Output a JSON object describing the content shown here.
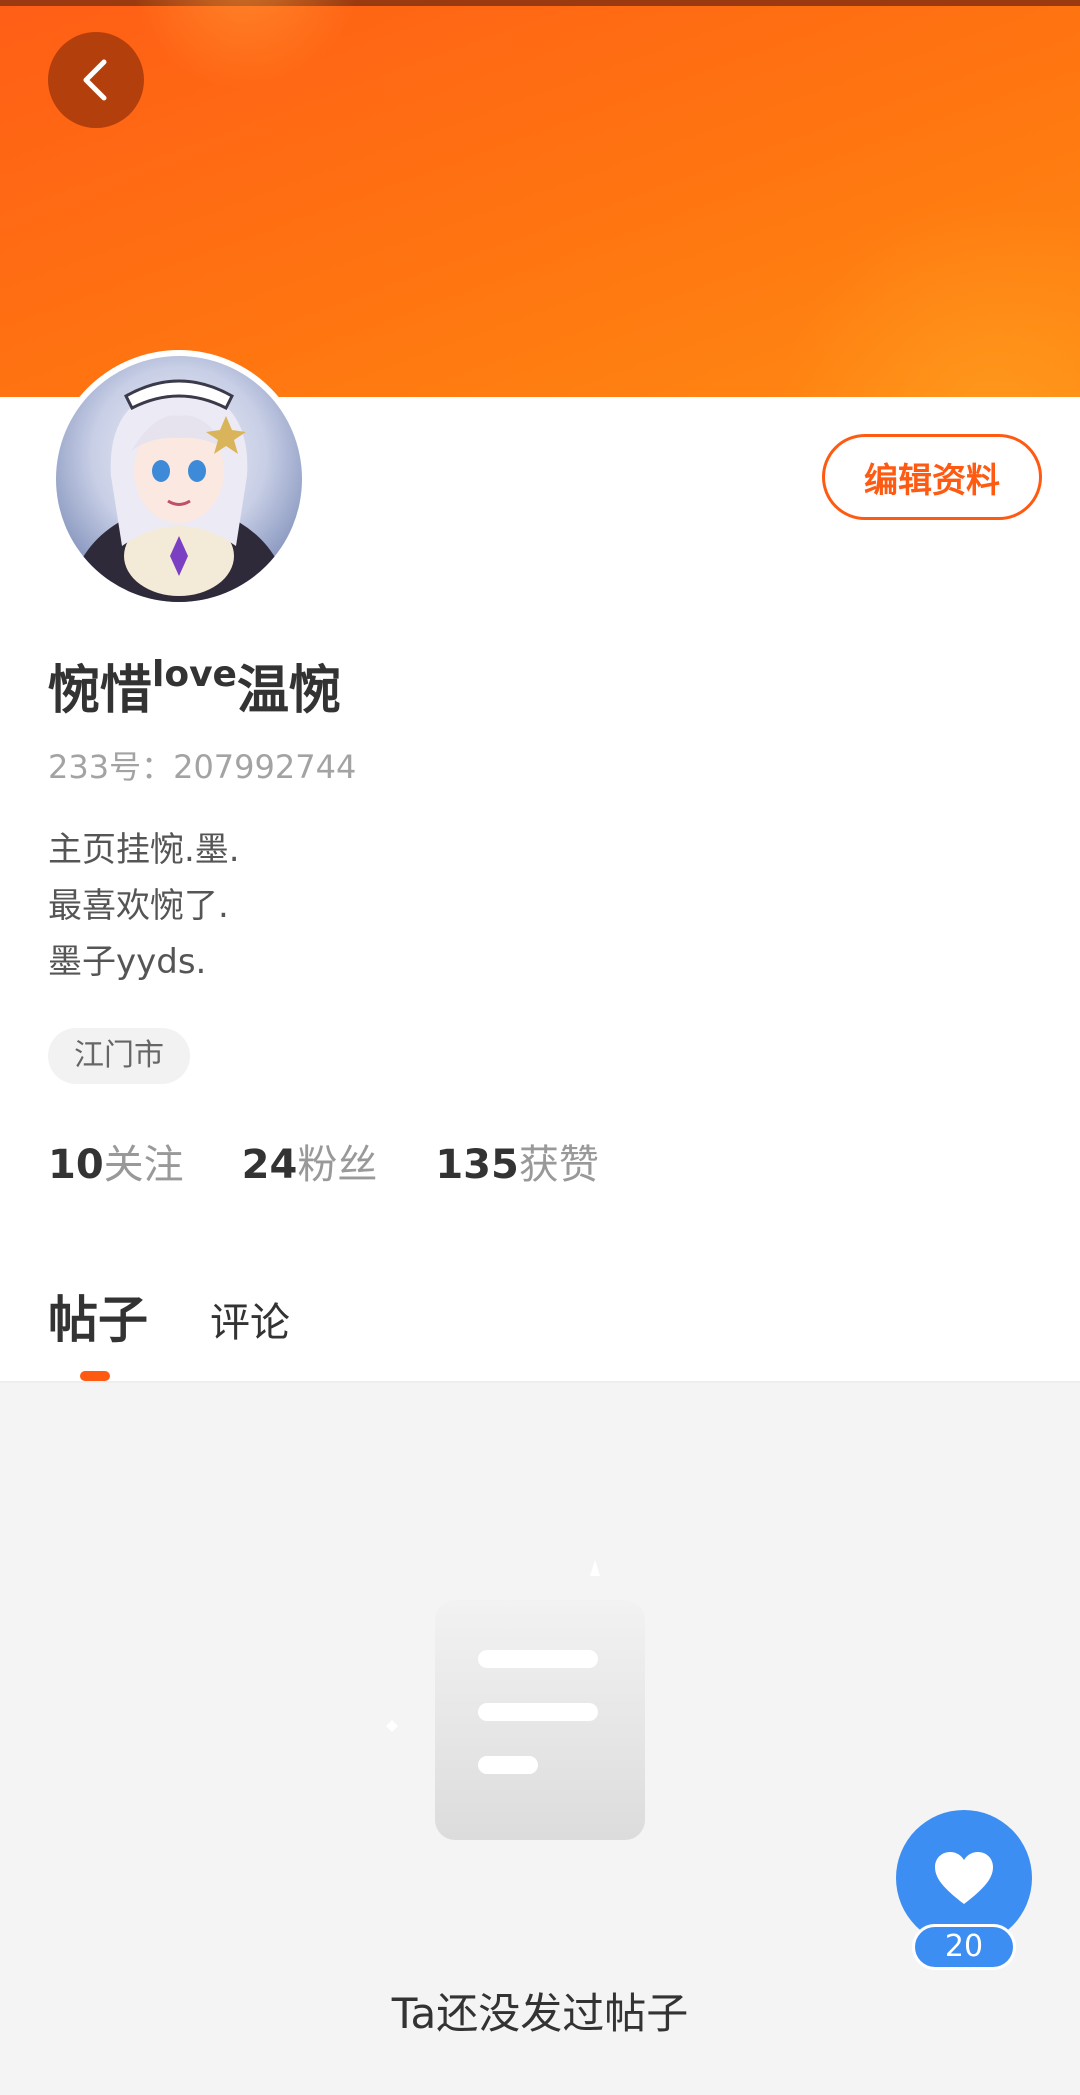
{
  "header": {
    "back_icon": "chevron-left-icon",
    "edit_label": "编辑资料"
  },
  "profile": {
    "name_part1": "惋惜",
    "name_sup": "love",
    "name_part2": "温惋",
    "uid": "233号：207992744",
    "bio": [
      "主页挂惋.墨.",
      "最喜欢惋了.",
      "墨子yyds."
    ],
    "location": "江门市"
  },
  "stats": [
    {
      "num": "10",
      "label": "关注"
    },
    {
      "num": "24",
      "label": "粉丝"
    },
    {
      "num": "135",
      "label": "获赞"
    }
  ],
  "tabs": [
    {
      "label": "帖子",
      "active": true
    },
    {
      "label": "评论",
      "active": false
    }
  ],
  "content": {
    "empty_text": "Ta还没发过帖子",
    "empty_icon": "document-icon"
  },
  "fab": {
    "icon": "heart-icon",
    "count": "20"
  },
  "colors": {
    "accent": "#ff5a12",
    "fab_blue": "#3d8ef2",
    "banner_orange": "#ff7511"
  }
}
